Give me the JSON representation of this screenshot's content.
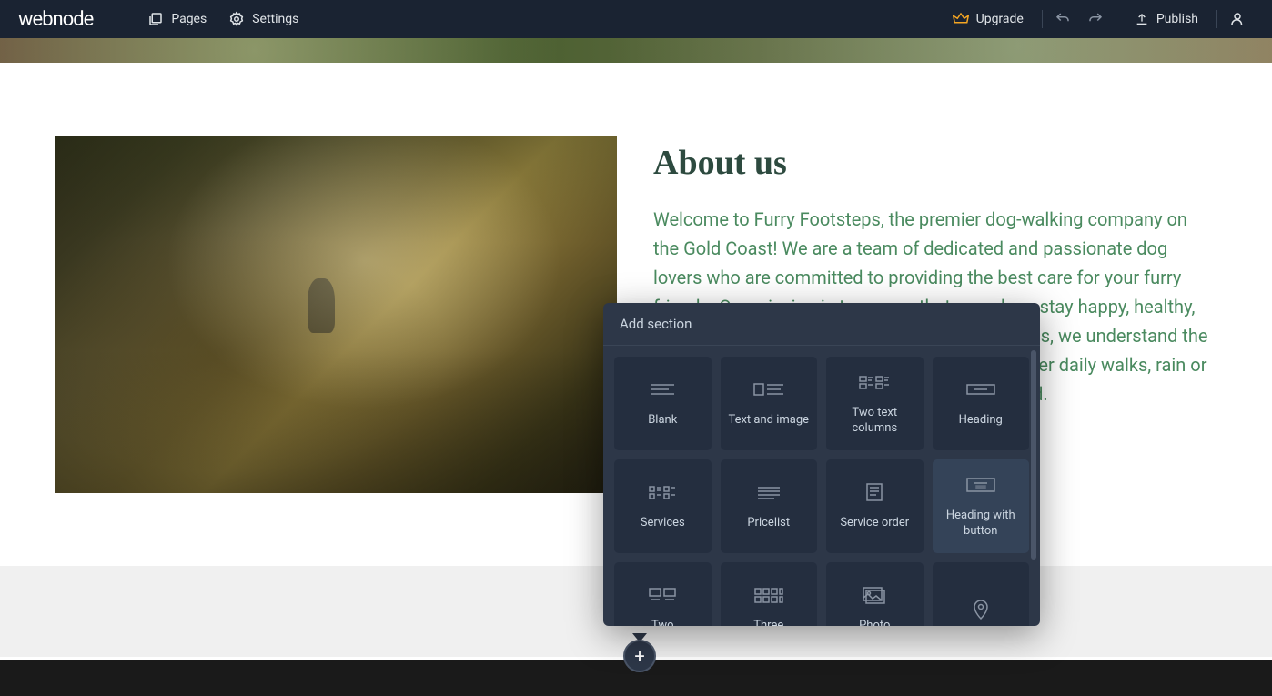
{
  "topbar": {
    "logo": "webnode",
    "nav_pages": "Pages",
    "nav_settings": "Settings",
    "upgrade": "Upgrade",
    "publish": "Publish"
  },
  "content": {
    "heading": "About us",
    "body": "Welcome to Furry Footsteps, the premier dog-walking company on the Gold Coast! We are a team of dedicated and passionate dog lovers who are committed to providing the best care for your furry friends. Our mission is to ensure that your dogs stay happy, healthy, and active while you are away. At Furry Footsteps, we understand the importance of regular, vigorous exercise. We offer daily walks, rain or shine, to keep your pets stimulated and engaged."
  },
  "popover": {
    "title": "Add section",
    "options": [
      {
        "label": "Blank",
        "icon": "lines"
      },
      {
        "label": "Text and image",
        "icon": "text-image"
      },
      {
        "label": "Two text columns",
        "icon": "two-cols"
      },
      {
        "label": "Heading",
        "icon": "heading"
      },
      {
        "label": "Services",
        "icon": "services"
      },
      {
        "label": "Pricelist",
        "icon": "pricelist"
      },
      {
        "label": "Service order",
        "icon": "service-order"
      },
      {
        "label": "Heading with button",
        "icon": "heading-button"
      },
      {
        "label": "Two",
        "icon": "two-blocks"
      },
      {
        "label": "Three",
        "icon": "three-blocks"
      },
      {
        "label": "Photo",
        "icon": "photo"
      },
      {
        "label": "",
        "icon": "map-pin"
      }
    ],
    "hovered_index": 7
  },
  "add_button": "+"
}
